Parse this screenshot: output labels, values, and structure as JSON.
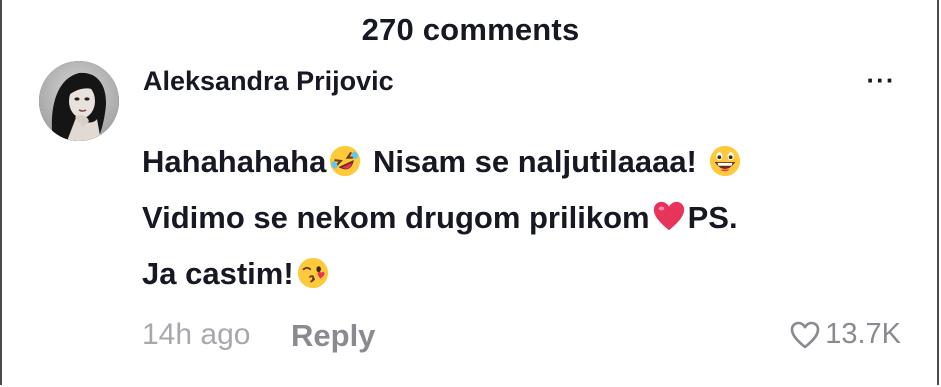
{
  "header": {
    "title": "270 comments"
  },
  "comment": {
    "username": "Aleksandra Prijovic",
    "avatar_icon": "avatar-photo",
    "more_icon": "more-dots-icon",
    "more_label": "···",
    "text_line1_a": "Hahahahaha",
    "emoji1": "rolling-laughing-emoji",
    "text_line1_b": " Nisam se naljutilaaaa! ",
    "emoji2": "grinning-emoji",
    "text_line2_a": "Vidimo se nekom drugom prilikom",
    "emoji3": "red-heart-emoji",
    "text_line2_b": "PS.",
    "text_line3_a": "Ja castim!",
    "emoji4": "kissing-heart-emoji",
    "timestamp": "14h ago",
    "reply_label": "Reply",
    "likes_count": "13.7K",
    "like_icon": "heart-outline-icon"
  },
  "colors": {
    "text": "#161823",
    "muted": "#8a8b91",
    "timestamp": "#a7a8ad",
    "heart": "#e8345a",
    "emoji_yellow": "#ffc93c"
  }
}
